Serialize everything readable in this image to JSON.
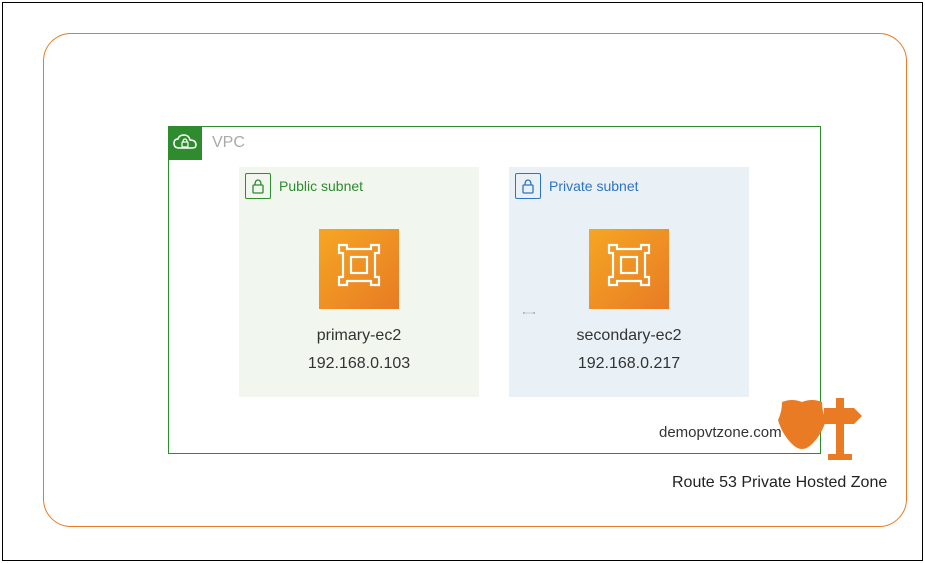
{
  "vpc": {
    "label": "VPC"
  },
  "subnets": {
    "public": {
      "label": "Public subnet",
      "instance_name": "primary-ec2",
      "instance_ip": "192.168.0.103"
    },
    "private": {
      "label": "Private subnet",
      "instance_name": "secondary-ec2",
      "instance_ip": "192.168.0.217"
    }
  },
  "route53": {
    "domain": "demopvtzone.com",
    "label": "Route 53 Private Hosted Zone"
  },
  "colors": {
    "region_border": "#e87b24",
    "vpc_border": "#2e8b2e",
    "public_accent": "#2e8b2e",
    "private_accent": "#2d74c4",
    "ec2_fill": "#e87b24"
  }
}
